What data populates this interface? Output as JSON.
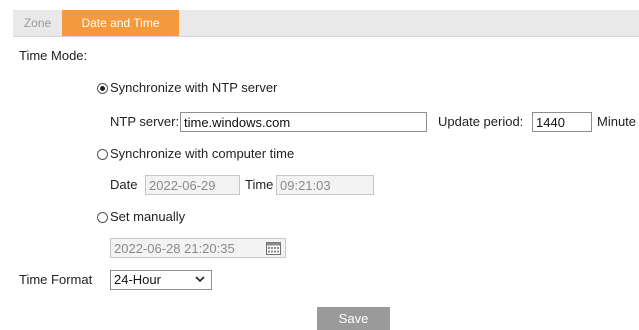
{
  "tabs": [
    {
      "label": "Zone",
      "active": false
    },
    {
      "label": "Date and Time",
      "active": true
    }
  ],
  "time_mode_label": "Time Mode:",
  "ntp": {
    "option_label": "Synchronize with NTP server",
    "selected": true,
    "server_label": "NTP server:",
    "server_value": "time.windows.com",
    "update_period_label": "Update period:",
    "update_period_value": "1440",
    "unit_label": "Minute"
  },
  "computer_sync": {
    "option_label": "Synchronize with computer time",
    "selected": false,
    "date_label": "Date",
    "date_value": "2022-06-29",
    "time_label": "Time",
    "time_value": "09:21:03"
  },
  "manual": {
    "option_label": "Set manually",
    "selected": false,
    "datetime_value": "2022-06-28 21:20:35",
    "calendar_icon": "calendar-icon"
  },
  "time_format": {
    "label": "Time Format",
    "selected": "24-Hour"
  },
  "save_label": "Save",
  "colors": {
    "active_tab": "#f59a3c",
    "tab_bar": "#e9e9e9",
    "save_button": "#9a9a9a"
  }
}
